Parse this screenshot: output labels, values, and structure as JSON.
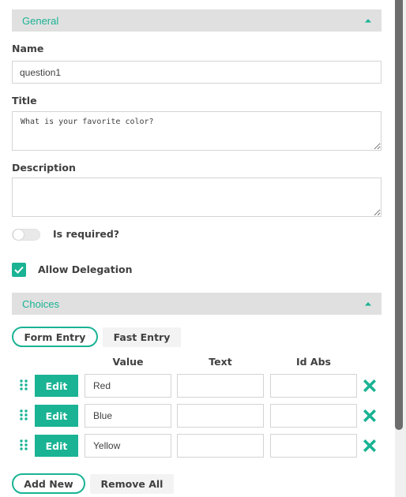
{
  "general": {
    "header": "General",
    "name_label": "Name",
    "name_value": "question1",
    "title_label": "Title",
    "title_value": "What is your favorite color?",
    "description_label": "Description",
    "description_value": "",
    "required_label": "Is required?",
    "required_checked": false,
    "delegation_label": "Allow Delegation",
    "delegation_checked": true
  },
  "choices": {
    "header": "Choices",
    "tabs": [
      "Form Entry",
      "Fast Entry"
    ],
    "active_tab": "Form Entry",
    "columns": [
      "Value",
      "Text",
      "Id Abs"
    ],
    "edit_label": "Edit",
    "rows": [
      {
        "value": "Red",
        "text": "",
        "id_abs": ""
      },
      {
        "value": "Blue",
        "text": "",
        "id_abs": ""
      },
      {
        "value": "Yellow",
        "text": "",
        "id_abs": ""
      }
    ],
    "add_new_label": "Add New",
    "remove_all_label": "Remove All"
  },
  "icons": {
    "collapse": "chevron-up-icon",
    "drag": "drag-handle-icon",
    "remove": "close-icon",
    "check": "check-icon"
  },
  "colors": {
    "accent": "#1ab394",
    "header_bg": "#e0e0e0",
    "text": "#404040"
  }
}
